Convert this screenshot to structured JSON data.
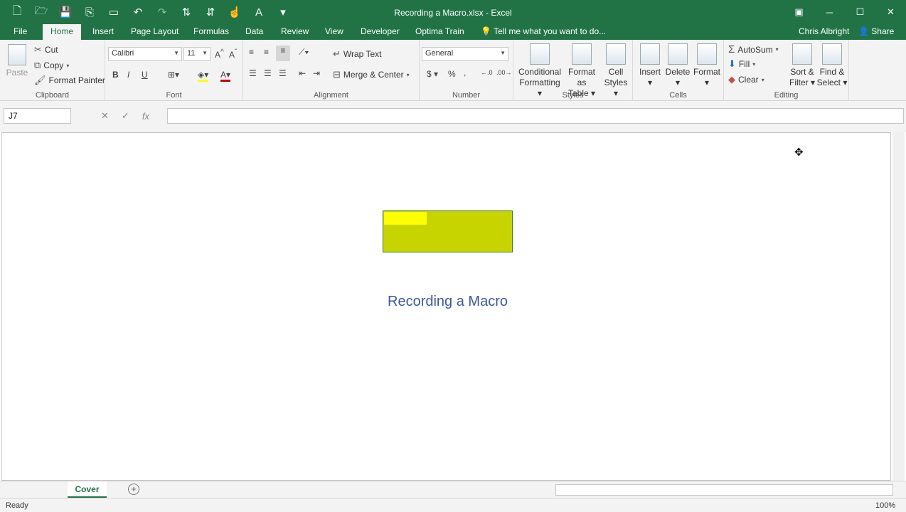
{
  "app": {
    "window_title": "Recording a Macro.xlsx - Excel",
    "user": "Chris Albright",
    "share_label": "Share",
    "tell_me": "Tell me what you want to do..."
  },
  "tabs": [
    "File",
    "Home",
    "Insert",
    "Page Layout",
    "Formulas",
    "Data",
    "Review",
    "View",
    "Developer",
    "Optima Train"
  ],
  "ribbon": {
    "clipboard": {
      "paste": "Paste",
      "cut": "Cut",
      "copy": "Copy",
      "format_painter": "Format Painter",
      "label": "Clipboard"
    },
    "font": {
      "name": "Calibri",
      "size": "11",
      "bold": "B",
      "italic": "I",
      "underline": "U",
      "label": "Font"
    },
    "alignment": {
      "wrap_text": "Wrap Text",
      "merge_center": "Merge & Center",
      "label": "Alignment"
    },
    "number": {
      "format": "General",
      "currency": "$",
      "percent": "%",
      "comma": ",",
      "label": "Number"
    },
    "styles": {
      "conditional": [
        "Conditional",
        "Formatting"
      ],
      "format_table": [
        "Format as",
        "Table"
      ],
      "cell_styles": [
        "Cell",
        "Styles"
      ],
      "label": "Styles"
    },
    "cells": {
      "insert": "Insert",
      "delete": "Delete",
      "format": "Format",
      "label": "Cells"
    },
    "editing": {
      "autosum": "AutoSum",
      "fill": "Fill",
      "clear": "Clear",
      "sort": [
        "Sort &",
        "Filter"
      ],
      "find": [
        "Find &",
        "Select"
      ],
      "label": "Editing"
    }
  },
  "formula_bar": {
    "name_box": "J7",
    "fx": "fx",
    "value": ""
  },
  "sheet": {
    "title": "Recording a Macro"
  },
  "sheet_tabs": [
    {
      "label": "Cover",
      "active": true
    }
  ],
  "status": {
    "ready": "Ready",
    "zoom": "100%"
  }
}
